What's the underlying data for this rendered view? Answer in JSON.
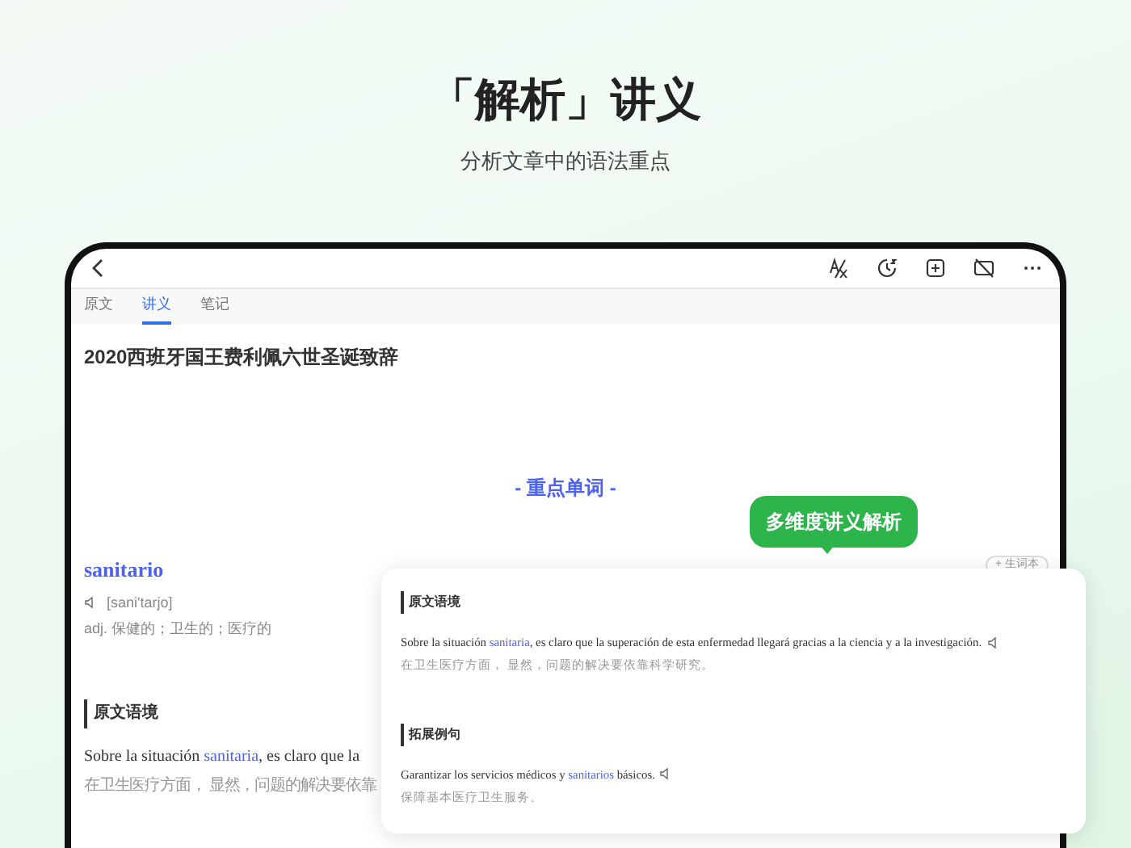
{
  "header": {
    "title": "「解析」讲义",
    "subtitle": "分析文章中的语法重点"
  },
  "tabs": [
    {
      "label": "原文",
      "selected": false
    },
    {
      "label": "讲义",
      "selected": true
    },
    {
      "label": "笔记",
      "selected": false
    }
  ],
  "article_title": "2020西班牙国王费利佩六世圣诞致辞",
  "section_heading": "- 重点单词 -",
  "word": {
    "term": "sanitario",
    "phonetic": "[sani'tarjo]",
    "definition": "adj. 保健的；卫生的；医疗的",
    "add_button": "+ 生词本"
  },
  "context": {
    "heading": "原文语境",
    "sentence": {
      "before": "Sobre la situación ",
      "keyword": "sanitaria",
      "after": ", es claro que la"
    },
    "translation": "在卫生医疗方面， 显然，问题的解决要依靠"
  },
  "callout": "多维度讲义解析",
  "popup": {
    "sections": [
      {
        "heading": "原文语境",
        "sentence": {
          "before": "Sobre la situación ",
          "keyword": "sanitaria",
          "after": ", es claro que la superación de esta enfermedad llegará gracias a la ciencia y a la investigación."
        },
        "translation": "在卫生医疗方面， 显然，问题的解决要依靠科学研究。"
      },
      {
        "heading": "拓展例句",
        "sentence": {
          "before": "Garantizar los servicios médicos y ",
          "keyword": "sanitarios",
          "after": " básicos."
        },
        "translation": "保障基本医疗卫生服务。"
      }
    ]
  }
}
